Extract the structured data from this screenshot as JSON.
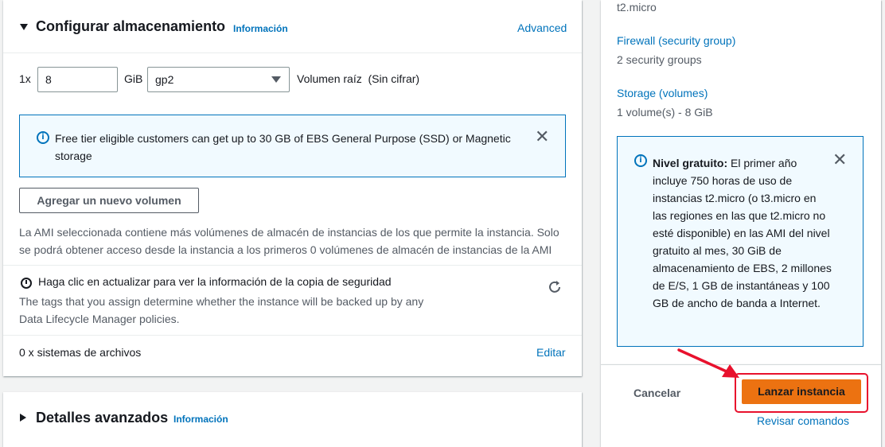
{
  "storage": {
    "title": "Configurar almacenamiento",
    "info_label": "Información",
    "advanced_link": "Advanced",
    "volume_count": "1x",
    "size_value": "8",
    "size_unit": "GiB",
    "volume_type": "gp2",
    "volume_desc": "Volumen raíz  (Sin cifrar)",
    "free_tier_notice": "Free tier eligible customers can get up to 30 GB of EBS General Purpose (SSD) or Magnetic storage",
    "add_volume_button": "Agregar un nuevo volumen",
    "ami_notice": "La AMI seleccionada contiene más volúmenes de almacén de instancias de los que permite la instancia. Solo se podrá obtener acceso desde la instancia a los primeros 0 volúmenes de almacén de instancias de la AMI",
    "backup_title": "Haga clic en actualizar para ver la información de la copia de seguridad",
    "backup_desc": "The tags that you assign determine whether the instance will be backed up by any Data Lifecycle Manager policies.",
    "filesystems_label": "0 x sistemas de archivos",
    "edit_link": "Editar"
  },
  "advanced": {
    "title": "Detalles avanzados",
    "info_label": "Información"
  },
  "summary": {
    "instance_type_value": "t2.micro",
    "firewall_label": "Firewall (security group)",
    "firewall_value": "2 security groups",
    "storage_label": "Storage (volumes)",
    "storage_value": "1 volume(s) - 8 GiB",
    "free_tier_bold": "Nivel gratuito:",
    "free_tier_text": " El primer año incluye 750 horas de uso de instancias t2.micro (o t3.micro en las regiones en las que t2.micro no esté disponible) en las AMI del nivel gratuito al mes, 30 GiB de almacenamiento de EBS, 2 millones de E/S, 1 GB de instantáneas y 100 GB de ancho de banda a Internet."
  },
  "actions": {
    "cancel": "Cancelar",
    "launch": "Lanzar instancia",
    "review_commands": "Revisar comandos"
  },
  "colors": {
    "accent": "#0073bb",
    "primary_button": "#ec7211",
    "annotation": "#e8112d"
  }
}
